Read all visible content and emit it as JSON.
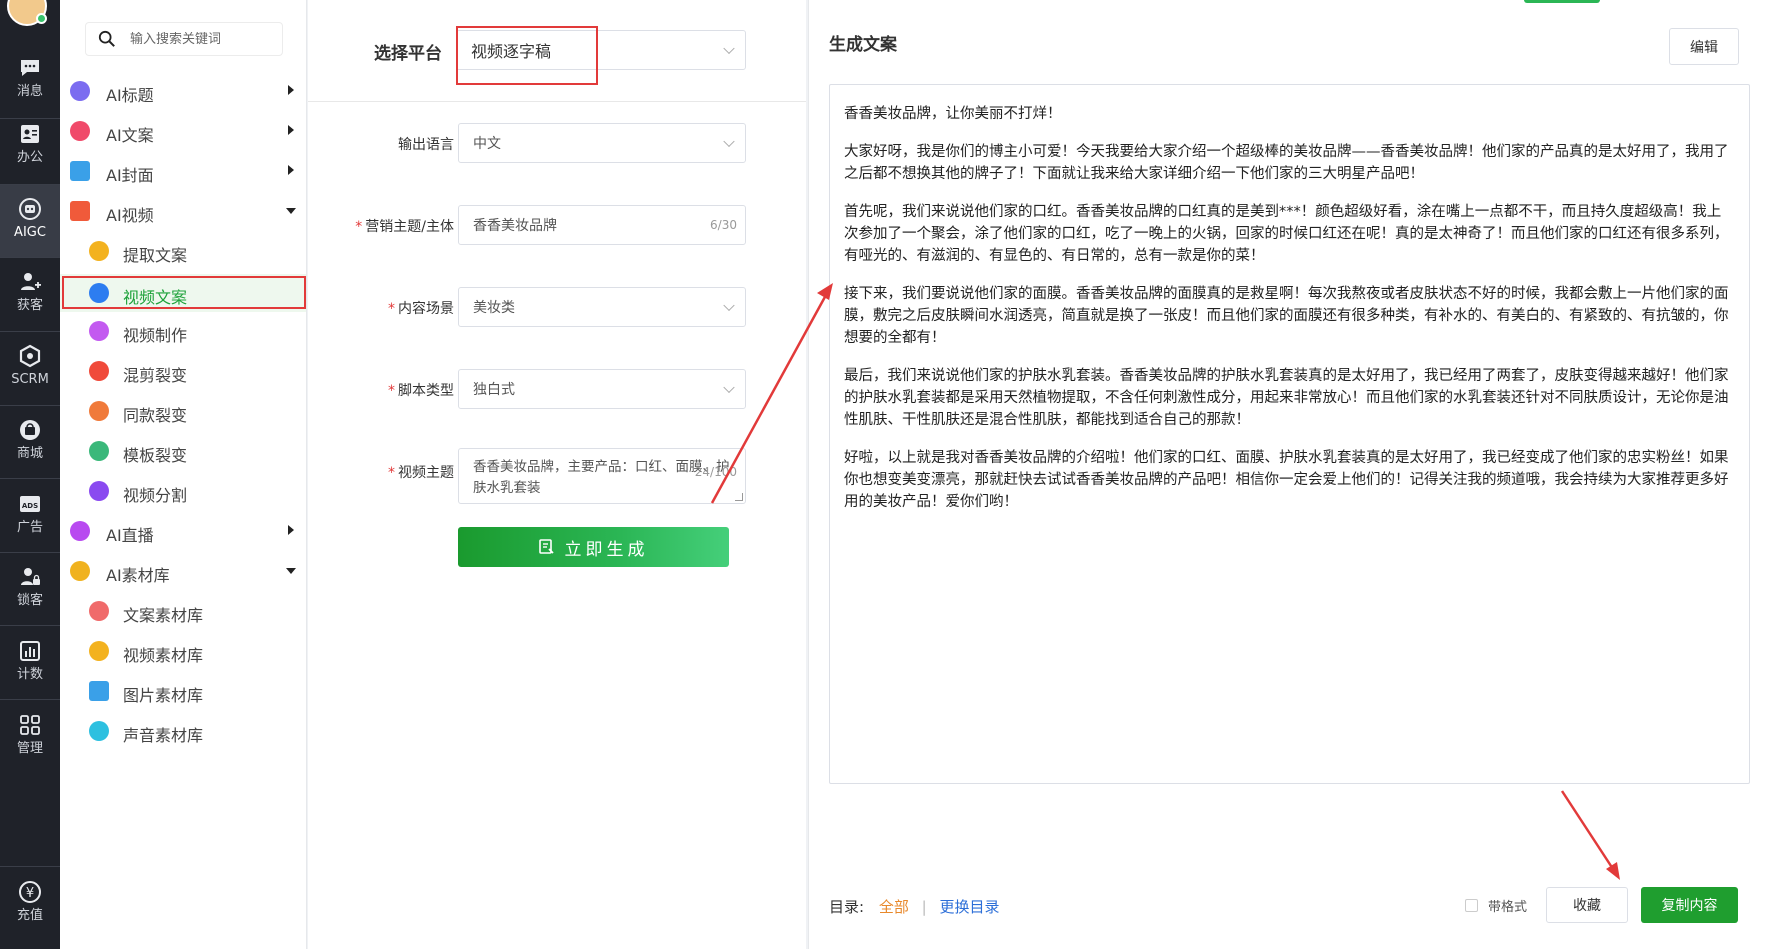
{
  "rail": {
    "items": [
      {
        "label": "消息",
        "icon": "chat-icon"
      },
      {
        "label": "办公",
        "icon": "contact-card-icon"
      },
      {
        "label": "AIGC",
        "icon": "ai-robot-icon"
      },
      {
        "label": "获客",
        "icon": "user-add-icon"
      },
      {
        "label": "SCRM",
        "icon": "scrm-hex-icon"
      },
      {
        "label": "商城",
        "icon": "shop-bag-icon"
      },
      {
        "label": "广告",
        "icon": "ads-icon"
      },
      {
        "label": "锁客",
        "icon": "user-lock-icon"
      },
      {
        "label": "计数",
        "icon": "bar-chart-icon"
      },
      {
        "label": "管理",
        "icon": "grid-icon"
      },
      {
        "label": "充值",
        "icon": "yen-icon"
      }
    ]
  },
  "sidebar": {
    "search_placeholder": "输入搜索关键词",
    "items": [
      {
        "label": "AI标题",
        "arrow": "right",
        "color": "#7b6cf0"
      },
      {
        "label": "AI文案",
        "arrow": "right",
        "color": "#f04a6a"
      },
      {
        "label": "AI封面",
        "arrow": "right",
        "color": "#3aa0e8"
      },
      {
        "label": "AI视频",
        "arrow": "down",
        "color": "#f05a3a"
      },
      {
        "label": "提取文案",
        "sub": true,
        "color": "#f3b21f"
      },
      {
        "label": "视频文案",
        "sub": true,
        "active": true,
        "color": "#2d7df0"
      },
      {
        "label": "视频制作",
        "sub": true,
        "color": "#c35af0"
      },
      {
        "label": "混剪裂变",
        "sub": true,
        "color": "#f04a3a"
      },
      {
        "label": "同款裂变",
        "sub": true,
        "color": "#f07a3a"
      },
      {
        "label": "模板裂变",
        "sub": true,
        "color": "#3ab87a"
      },
      {
        "label": "视频分割",
        "sub": true,
        "color": "#8a4af0"
      },
      {
        "label": "AI直播",
        "arrow": "right",
        "color": "#b84af0"
      },
      {
        "label": "AI素材库",
        "arrow": "down",
        "color": "#f0b21f"
      },
      {
        "label": "文案素材库",
        "sub": true,
        "color": "#f06a6a"
      },
      {
        "label": "视频素材库",
        "sub": true,
        "color": "#f3b21f"
      },
      {
        "label": "图片素材库",
        "sub": true,
        "color": "#3aa0e8"
      },
      {
        "label": "声音素材库",
        "sub": true,
        "color": "#2dc0e0"
      }
    ]
  },
  "form": {
    "platform_label": "选择平台",
    "platform_value": "视频逐字稿",
    "language_label": "输出语言",
    "language_value": "中文",
    "topic_label": "营销主题/主体",
    "topic_value": "香香美妆品牌",
    "topic_count": "6/30",
    "scene_label": "内容场景",
    "scene_value": "美妆类",
    "script_label": "脚本类型",
    "script_value": "独白式",
    "video_topic_label": "视频主题",
    "video_topic_value": "香香美妆品牌，主要产品：口红、面膜、护肤水乳套装",
    "video_topic_count": "24/100",
    "generate_label": "立即生成"
  },
  "result": {
    "title": "生成文案",
    "edit_label": "编辑",
    "paragraphs": [
      "香香美妆品牌，让你美丽不打烊！",
      "大家好呀，我是你们的博主小可爱！今天我要给大家介绍一个超级棒的美妆品牌——香香美妆品牌！他们家的产品真的是太好用了，我用了之后都不想换其他的牌子了！下面就让我来给大家详细介绍一下他们家的三大明星产品吧！",
      "首先呢，我们来说说他们家的口红。香香美妆品牌的口红真的是美到***！颜色超级好看，涂在嘴上一点都不干，而且持久度超级高！我上次参加了一个聚会，涂了他们家的口红，吃了一晚上的火锅，回家的时候口红还在呢！真的是太神奇了！而且他们家的口红还有很多系列，有哑光的、有滋润的、有显色的、有日常的，总有一款是你的菜！",
      "接下来，我们要说说他们家的面膜。香香美妆品牌的面膜真的是救星啊！每次我熬夜或者皮肤状态不好的时候，我都会敷上一片他们家的面膜，敷完之后皮肤瞬间水润透亮，简直就是换了一张皮！而且他们家的面膜还有很多种类，有补水的、有美白的、有紧致的、有抗皱的，你想要的全都有！",
      "最后，我们来说说他们家的护肤水乳套装。香香美妆品牌的护肤水乳套装真的是太好用了，我已经用了两套了，皮肤变得越来越好！他们家的护肤水乳套装都是采用天然植物提取，不含任何刺激性成分，用起来非常放心！而且他们家的水乳套装还针对不同肤质设计，无论你是油性肌肤、干性肌肤还是混合性肌肤，都能找到适合自己的那款！",
      "好啦，以上就是我对香香美妆品牌的介绍啦！他们家的口红、面膜、护肤水乳套装真的是太好用了，我已经变成了他们家的忠实粉丝！如果你也想变美变漂亮，那就赶快去试试香香美妆品牌的产品吧！相信你一定会爱上他们的！记得关注我的频道哦，我会持续为大家推荐更多好用的美妆产品！爱你们哟！"
    ],
    "toc_label": "目录:",
    "toc_all": "全部",
    "toc_sep": "|",
    "toc_change": "更换目录",
    "format_label": "带格式",
    "fav_label": "收藏",
    "copy_label": "复制内容"
  },
  "colors": {
    "accent_green": "#1f9e2f",
    "highlight_red": "#e23a3a",
    "rail_bg": "#1f2229"
  }
}
